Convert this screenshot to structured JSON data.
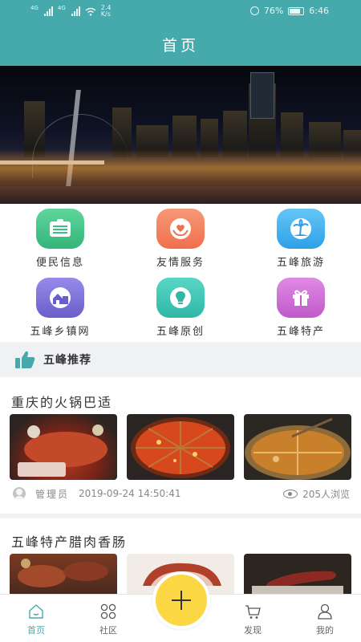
{
  "status_bar": {
    "signal1_tag": "4G",
    "signal2_tag": "4G",
    "net_speed_value": "2.4",
    "net_speed_unit": "K/s",
    "battery": "76%",
    "time": "6:46"
  },
  "header": {
    "title": "首页"
  },
  "banner": {
    "image": "chongqing-night-skyline"
  },
  "services": [
    {
      "label": "便民信息",
      "icon": "notice-board-icon",
      "color": "#3cbf85"
    },
    {
      "label": "友情服务",
      "icon": "heart-hands-icon",
      "color": "#f6845f"
    },
    {
      "label": "五峰旅游",
      "icon": "palm-island-icon",
      "color": "#45b4ef"
    },
    {
      "label": "五峰乡镇网",
      "icon": "town-house-icon",
      "color": "#7e72d6"
    },
    {
      "label": "五峰原创",
      "icon": "lightbulb-icon",
      "color": "#3dc6b5"
    },
    {
      "label": "五峰特产",
      "icon": "gift-box-icon",
      "color": "#cf6fd6"
    }
  ],
  "section": {
    "title": "五峰推荐",
    "icon": "thumbs-up-icon"
  },
  "articles": [
    {
      "title": "重庆的火锅巴适",
      "author": "管理员",
      "date": "2019-09-24 14:50:41",
      "views": "205人浏览"
    },
    {
      "title": "五峰特产腊肉香肠"
    }
  ],
  "tabbar": {
    "items": [
      {
        "label": "首页",
        "icon": "home-icon",
        "active": true
      },
      {
        "label": "社区",
        "icon": "grid-circles-icon",
        "active": false
      },
      {
        "label": "发现",
        "icon": "cart-icon",
        "active": false
      },
      {
        "label": "我的",
        "icon": "user-icon",
        "active": false
      }
    ],
    "fab_icon": "plus-icon"
  },
  "colors": {
    "primary": "#46a9ab",
    "fab": "#fbd743",
    "section_bg": "#f0f1f5"
  }
}
